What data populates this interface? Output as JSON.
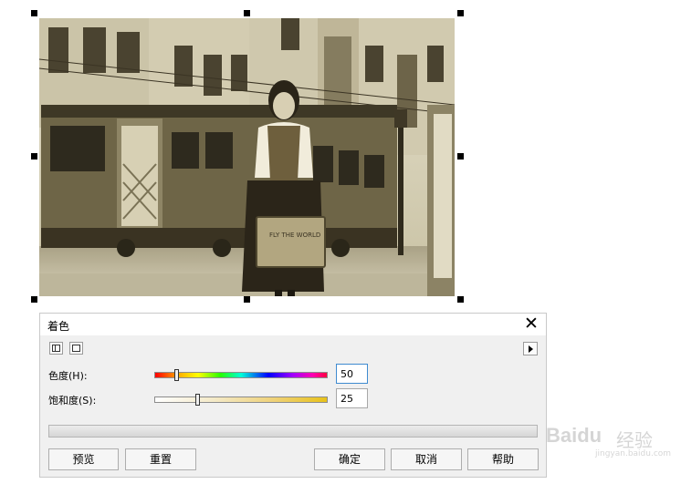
{
  "dialog": {
    "title": "着色",
    "close_icon": "close-icon",
    "hue": {
      "label": "色度(H):",
      "value": "50",
      "slider_fraction": 0.13
    },
    "saturation": {
      "label": "饱和度(S):",
      "value": "25",
      "slider_fraction": 0.25
    },
    "buttons": {
      "preview": "预览",
      "reset": "重置",
      "ok": "确定",
      "cancel": "取消",
      "help": "帮助"
    }
  },
  "watermark": {
    "brand": "Baidu",
    "cn": "经验",
    "sub": "jingyan.baidu.com"
  },
  "photo": {
    "sign_text": "FLY THE WORLD"
  },
  "colors": {
    "sepia_light": "#d7d1b8",
    "sepia_dark": "#3c3523",
    "focus_border": "#3f8bd0"
  }
}
